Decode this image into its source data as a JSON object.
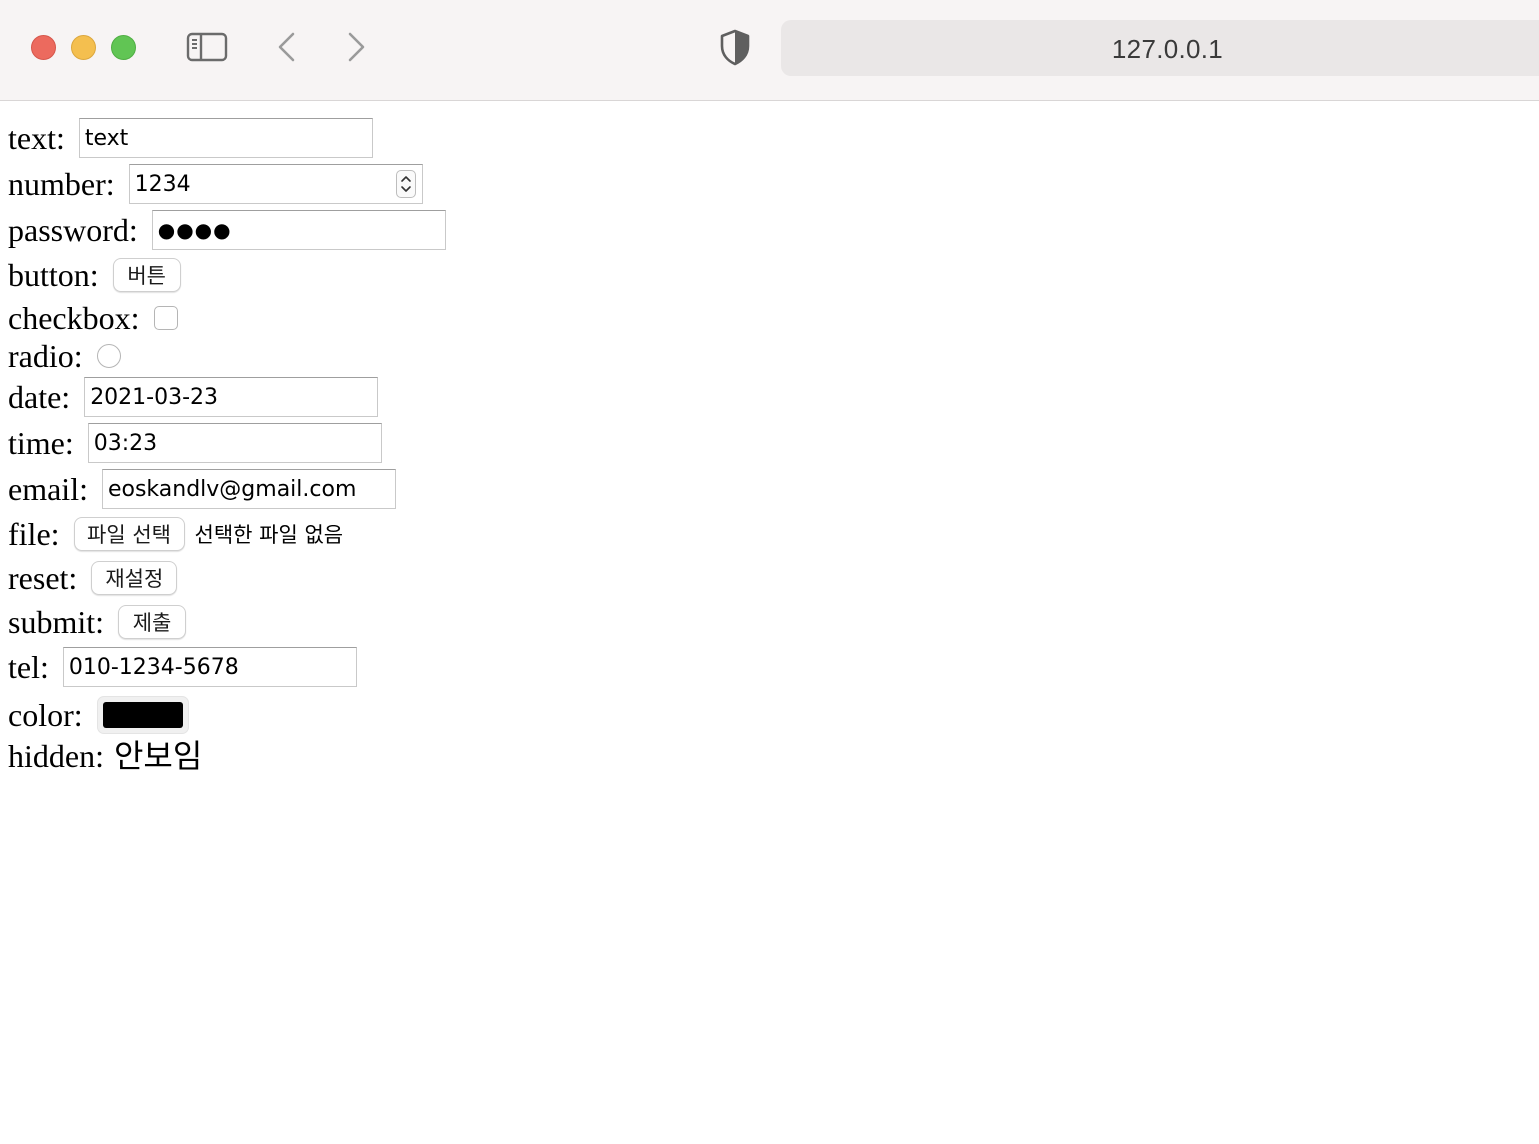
{
  "browser": {
    "url": "127.0.0.1"
  },
  "form": {
    "text": {
      "label": "text:",
      "value": "text"
    },
    "number": {
      "label": "number:",
      "value": "1234"
    },
    "password": {
      "label": "password:",
      "value": "●●●●"
    },
    "button": {
      "label": "button:",
      "button_text": "버튼"
    },
    "checkbox": {
      "label": "checkbox:",
      "checked": false
    },
    "radio": {
      "label": "radio:",
      "checked": false
    },
    "date": {
      "label": "date:",
      "value": "2021-03-23"
    },
    "time": {
      "label": "time:",
      "value": "03:23"
    },
    "email": {
      "label": "email:",
      "value": "eoskandlv@gmail.com"
    },
    "file": {
      "label": "file:",
      "button_text": "파일 선택",
      "status": "선택한 파일 없음"
    },
    "reset": {
      "label": "reset:",
      "button_text": "재설정"
    },
    "submit": {
      "label": "submit:",
      "button_text": "제출"
    },
    "tel": {
      "label": "tel:",
      "value": "010-1234-5678"
    },
    "color": {
      "label": "color:",
      "value": "#000000"
    },
    "hidden": {
      "label": "hidden:",
      "text": "안보임"
    }
  },
  "icons": {
    "close": "close-button",
    "minimize": "minimize-button",
    "zoom": "zoom-button",
    "sidebar": "sidebar-icon",
    "back": "chevron-left-icon",
    "forward": "chevron-right-icon",
    "privacy": "shield-icon"
  },
  "colors": {
    "traffic_red": "#ec6a5e",
    "traffic_yellow": "#f4bf4f",
    "traffic_green": "#61c554"
  }
}
